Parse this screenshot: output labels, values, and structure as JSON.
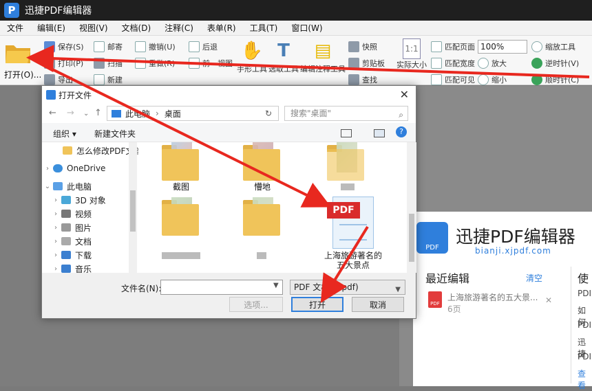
{
  "app": {
    "logo": "P",
    "title": "迅捷PDF编辑器"
  },
  "menu": [
    "文件",
    "编辑(E)",
    "视图(V)",
    "文档(D)",
    "注释(C)",
    "表单(R)",
    "工具(T)",
    "窗口(W)"
  ],
  "toolbar": {
    "open": "打开(O)...",
    "save": "保存(S)",
    "print": "打印(P)",
    "export": "导出",
    "email": "邮寄",
    "scan": "扫描",
    "new": "新建",
    "undo": "撤销(U)",
    "redo": "重做(R)",
    "back": "后退",
    "prev_view": "前一视图",
    "hand": "手形工具",
    "select": "选取工具",
    "edit_annot": "编辑注释工具",
    "snapshot": "快照",
    "clipboard": "剪贴板",
    "find": "查找",
    "actual_size": "实际大小",
    "fit_page": "匹配页面",
    "fit_width": "匹配宽度",
    "fit_visible": "匹配可见",
    "zoom_value": "100%",
    "zoom_in": "放大",
    "zoom_out": "缩小",
    "zoom_tool": "缩放工具",
    "rotate_ccw": "逆时针(V)",
    "rotate_cw": "顺时针(C)",
    "actual_size_icon": "1:1"
  },
  "dialog": {
    "title": "打开文件",
    "close": "✕",
    "path_root": "此电脑",
    "path_sep": "›",
    "path_current": "桌面",
    "search_placeholder": "搜索\"桌面\"",
    "organize": "组织 ▾",
    "new_folder": "新建文件夹",
    "help": "?",
    "nav_items": [
      {
        "label": "怎么修改PDF文档",
        "chev": ""
      },
      {
        "label": "OneDrive",
        "chev": "›"
      },
      {
        "label": "此电脑",
        "chev": "⌄"
      },
      {
        "label": "3D 对象",
        "chev": "›"
      },
      {
        "label": "视频",
        "chev": "›"
      },
      {
        "label": "图片",
        "chev": "›"
      },
      {
        "label": "文档",
        "chev": "›"
      },
      {
        "label": "下载",
        "chev": "›"
      },
      {
        "label": "音乐",
        "chev": "›"
      }
    ],
    "folders": [
      "截图",
      "懵地"
    ],
    "pdf_file": {
      "badge": "PDF",
      "name": "上海旅游著名的五大景点"
    },
    "filename_label": "文件名(N):",
    "filename_value": "",
    "filetype": "PDF 文档 (*.pdf)",
    "options": "选项...",
    "open": "打开",
    "cancel": "取消"
  },
  "panel": {
    "logo_text": "PDF",
    "brand": "迅捷PDF编辑器",
    "url": "bianji.xjpdf.com",
    "recent_title": "最近编辑",
    "clear": "清空",
    "recent_file": {
      "name": "上海旅游著名的五大景...",
      "pages": "6页",
      "close": "✕"
    },
    "side_title": "使",
    "side_items": [
      "PDI",
      "如何",
      "PDI",
      "迅捷",
      "PDI",
      "查看"
    ]
  },
  "colors": {
    "accent": "#2f7fdc",
    "arrow": "#e8281f",
    "pdf_red": "#d92b2b",
    "folder": "#f0c45a"
  }
}
